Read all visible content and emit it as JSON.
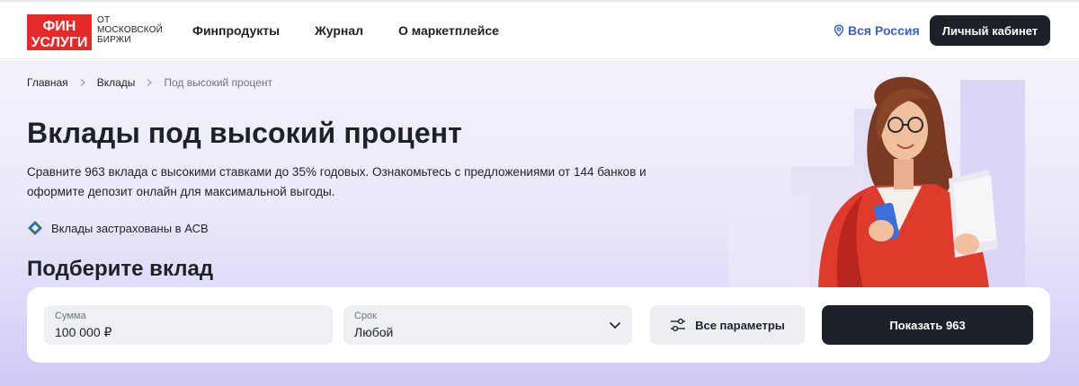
{
  "header": {
    "logo": {
      "line1": "ФИН",
      "line2": "УСЛУГИ"
    },
    "logo_sub": [
      "ОТ",
      "МОСКОВСКОЙ",
      "БИРЖИ"
    ],
    "nav": [
      "Финпродукты",
      "Журнал",
      "О маркетплейсе"
    ],
    "region_label": "Вся Россия",
    "cabinet_label": "Личный кабинет"
  },
  "breadcrumb": [
    "Главная",
    "Вклады",
    "Под высокий процент"
  ],
  "hero": {
    "title": "Вклады под высокий процент",
    "description": "Сравните 963 вклада с высокими ставками до 35% годовых. Ознакомьтесь с предложениями от 144 банков и оформите депозит онлайн для максимальной выгоды.",
    "insurance_note": "Вклады застрахованы в АСВ",
    "section_title": "Подберите вклад"
  },
  "filter": {
    "sum_label": "Сумма",
    "sum_value": "100 000 ₽",
    "term_label": "Срок",
    "term_value": "Любой",
    "params_label": "Все параметры",
    "show_label": "Показать 963"
  },
  "colors": {
    "logo_red": "#e52b2a",
    "accent_blue": "#3d5fc9",
    "dark_button": "#1f2129",
    "hero_bg": "#ebe9fb"
  },
  "icons": {
    "region": "location-pin-icon",
    "asv": "asv-logo-icon",
    "params": "sliders-icon",
    "term": "chevron-down-icon",
    "breadcrumb_sep": "chevron-right-icon"
  }
}
